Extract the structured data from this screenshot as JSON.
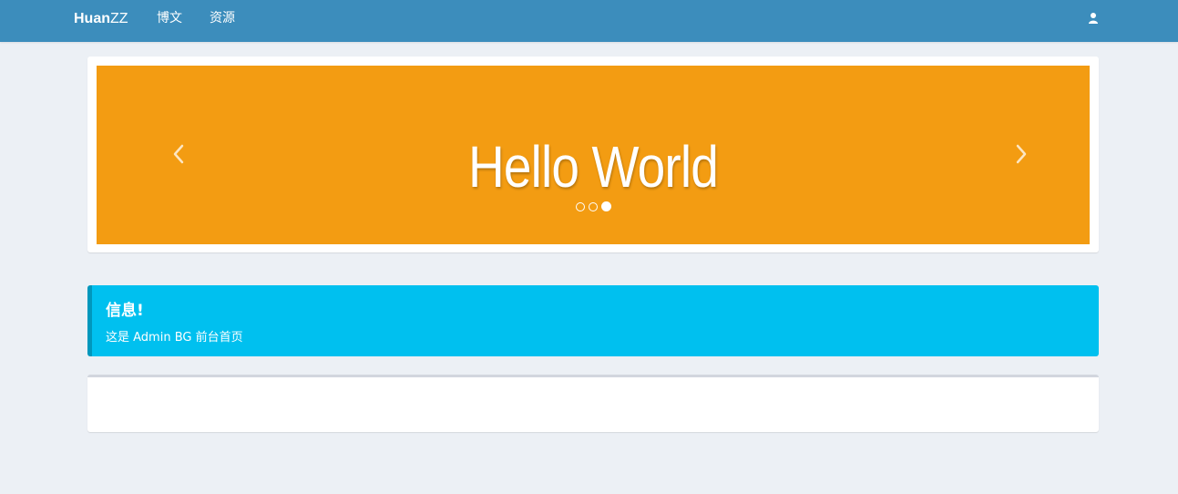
{
  "navbar": {
    "brand_bold": "Huan",
    "brand_rest": "ZZ",
    "items": [
      {
        "label": "博文"
      },
      {
        "label": "资源"
      }
    ],
    "user_icon": "user-icon",
    "color": "#3c8dbc"
  },
  "carousel": {
    "slide_text": "Hello World",
    "background": "#f39c12",
    "prev_icon": "chevron-left-icon",
    "next_icon": "chevron-right-icon",
    "indicator_count": 3,
    "active_indicator": 3
  },
  "callout": {
    "title": "信息!",
    "text": "这是 Admin BG 前台首页",
    "color": "#00c0ef"
  }
}
